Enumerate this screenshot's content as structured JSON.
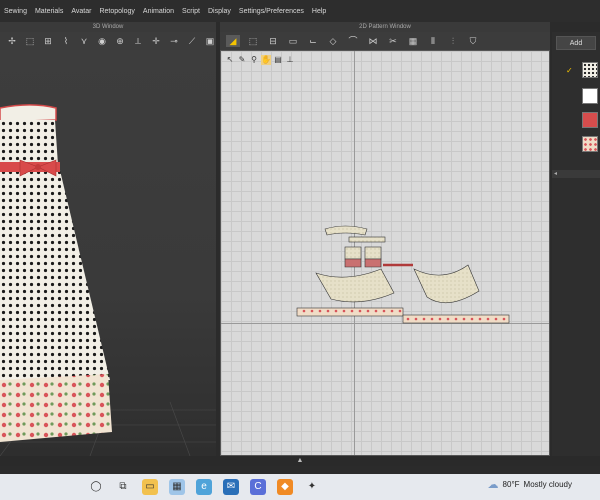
{
  "menu": [
    "Sewing",
    "Materials",
    "Avatar",
    "Retopology",
    "Animation",
    "Script",
    "Display",
    "Settings/Preferences",
    "Help"
  ],
  "windows": {
    "left_title": "3D Window",
    "center_title": "2D Pattern Window"
  },
  "sidebar": {
    "add_label": "Add"
  },
  "taskbar": {
    "temperature": "80°F",
    "condition": "Mostly cloudy"
  }
}
